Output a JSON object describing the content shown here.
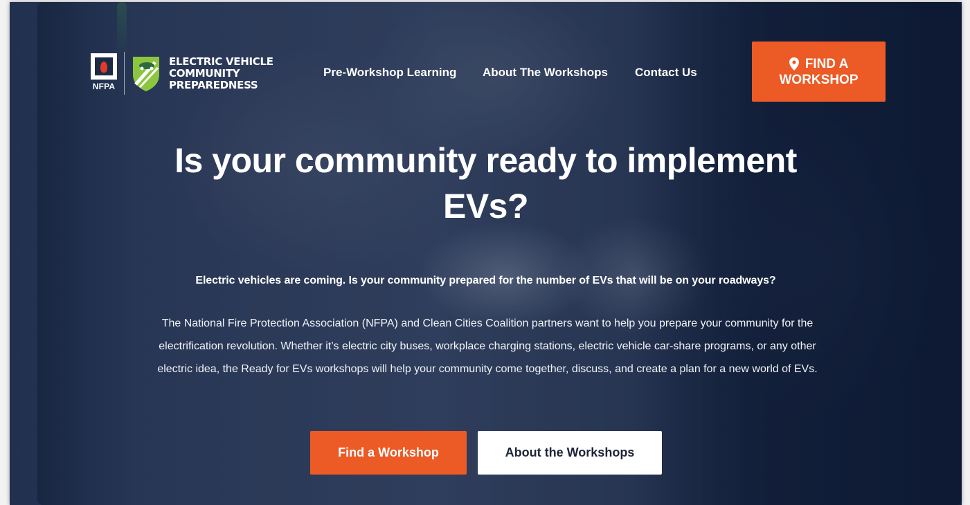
{
  "colors": {
    "accent": "#ec5a26",
    "overlay": "#0e1e3c",
    "text": "#ffffff",
    "secondary_button_bg": "#ffffff",
    "secondary_button_text": "#1d2437"
  },
  "logo": {
    "nfpa_text": "NFPA",
    "words_line1": "ELECTRIC VEHICLE",
    "words_line2": "COMMUNITY",
    "words_line3": "PREPAREDNESS",
    "nfpa_icon": "nfpa-flame-logo",
    "badge_icon": "ev-car-badge-icon"
  },
  "nav": {
    "items": [
      {
        "label": "Pre-Workshop Learning"
      },
      {
        "label": "About The Workshops"
      },
      {
        "label": "Contact Us"
      }
    ]
  },
  "header_cta": {
    "line1": "FIND A",
    "line2": "WORKSHOP",
    "icon": "map-pin-icon"
  },
  "hero": {
    "headline_line1": "Is your community ready to implement",
    "headline_line2": "EVs?",
    "subheading": "Electric vehicles are coming. Is your community prepared for the number of EVs that will be on your roadways?",
    "body": "The National Fire Protection Association (NFPA) and Clean Cities Coalition partners want to help you prepare your community for the electrification revolution. Whether it’s electric city buses, workplace charging stations, electric vehicle car-share programs, or any other electric idea, the Ready for EVs workshops will help your community come together, discuss, and create a plan for a new world of EVs.",
    "primary_button": "Find a Workshop",
    "secondary_button": "About the Workshops"
  }
}
